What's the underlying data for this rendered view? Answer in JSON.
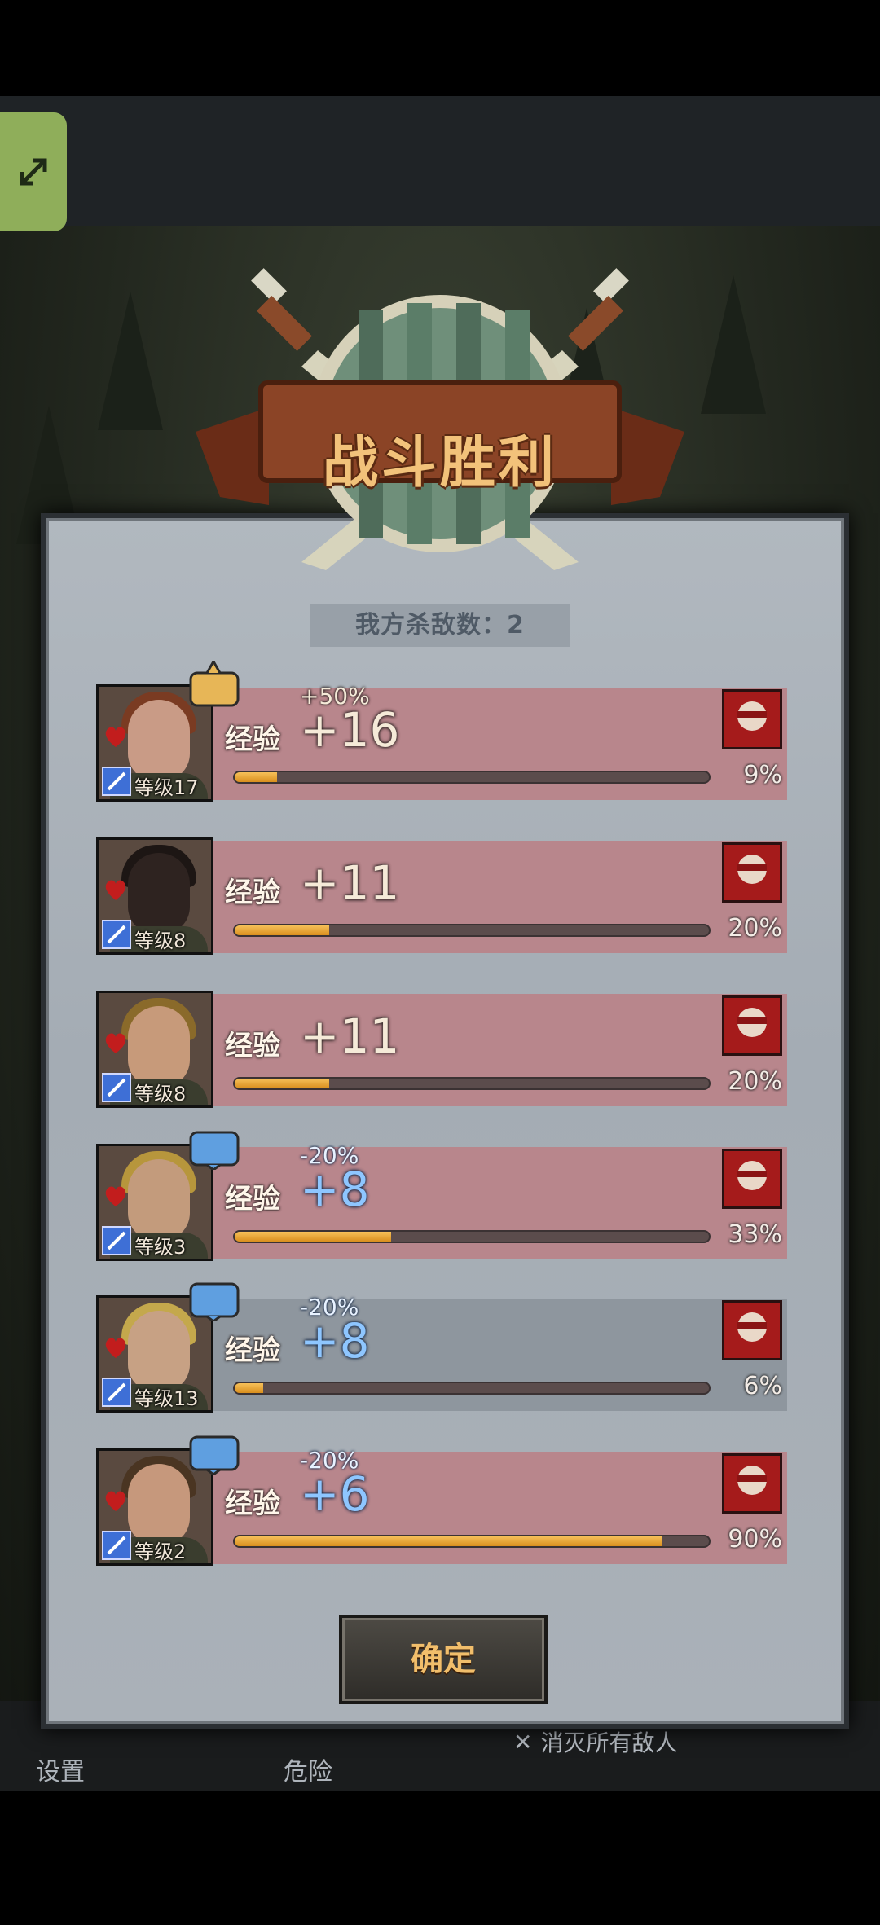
{
  "title": "战斗胜利",
  "kills_label": "我方杀敌数：2",
  "exp_label": "经验",
  "confirm_label": "确定",
  "bottom_bar": {
    "settings": "设置",
    "danger": "危险",
    "objective": "消灭所有敌人"
  },
  "heroes": [
    {
      "level": "等级17",
      "modifier": "+50%",
      "exp": "+16",
      "progress_pct": 9,
      "pct_text": "9%",
      "mood": "thumbs-up",
      "highlighted": true
    },
    {
      "level": "等级8",
      "modifier": "",
      "exp": "+11",
      "progress_pct": 20,
      "pct_text": "20%",
      "mood": "",
      "highlighted": true
    },
    {
      "level": "等级8",
      "modifier": "",
      "exp": "+11",
      "progress_pct": 20,
      "pct_text": "20%",
      "mood": "",
      "highlighted": true
    },
    {
      "level": "等级3",
      "modifier": "-20%",
      "exp": "+8",
      "progress_pct": 33,
      "pct_text": "33%",
      "mood": "thumbs-down",
      "highlighted": true
    },
    {
      "level": "等级13",
      "modifier": "-20%",
      "exp": "+8",
      "progress_pct": 6,
      "pct_text": "6%",
      "mood": "thumbs-down",
      "highlighted": false
    },
    {
      "level": "等级2",
      "modifier": "-20%",
      "exp": "+6",
      "progress_pct": 90,
      "pct_text": "90%",
      "mood": "thumbs-down",
      "highlighted": true
    }
  ],
  "colors": {
    "highlight_row": "#b8868c",
    "normal_row": "#8e969e",
    "progress_fill": "#e5a22c",
    "title_text": "#f2c27a",
    "penalty_text": "#8ec6ff"
  }
}
